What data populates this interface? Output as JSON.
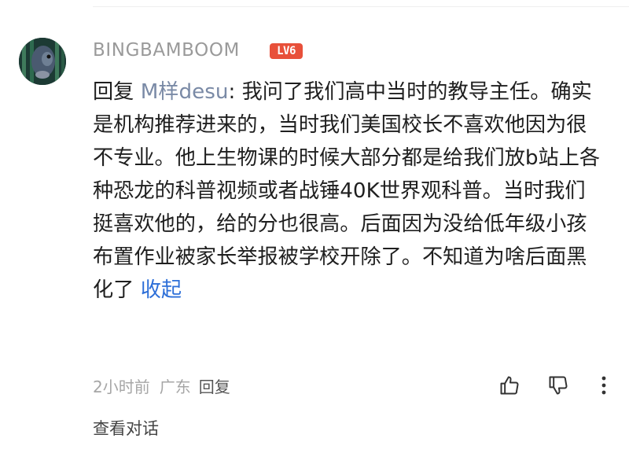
{
  "comment": {
    "username": "BINGBAMBOOM",
    "level_badge": "LV6",
    "reply_prefix": "回复 ",
    "mention": "M样desu",
    "text": ": 我问了我们高中当时的教导主任。确实是机构推荐进来的，当时我们美国校长不喜欢他因为很不专业。他上生物课的时候大部分都是给我们放b站上各种恐龙的科普视频或者战锤40K世界观科普。当时我们挺喜欢他的，给的分也很高。后面因为没给低年级小孩布置作业被家长举报被学校开除了。不知道为啥后面黑化了 ",
    "collapse_label": "收起",
    "time": "2小时前",
    "location": "广东",
    "reply_label": "回复",
    "view_conversation": "查看对话"
  },
  "icons": {
    "like": "thumbs-up-icon",
    "dislike": "thumbs-down-icon",
    "more": "more-vertical-icon"
  },
  "colors": {
    "level_badge": "#e8503a",
    "mention": "#7a8aa6",
    "link": "#2d6fd8",
    "meta": "#a6a6a6"
  }
}
